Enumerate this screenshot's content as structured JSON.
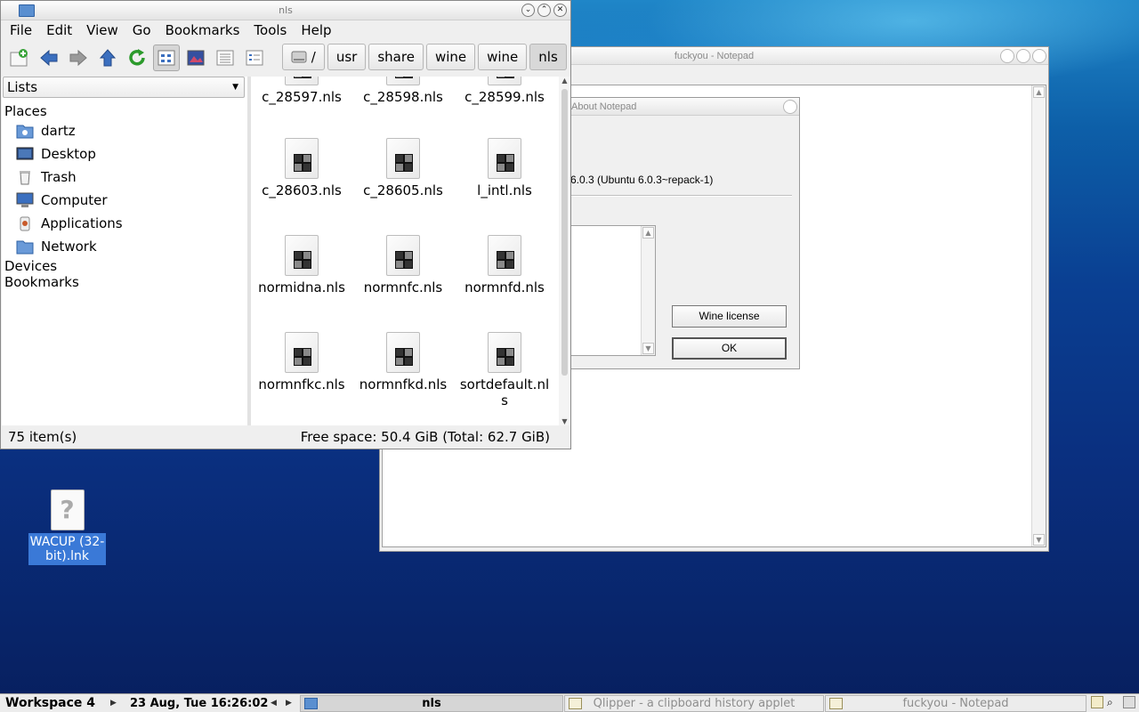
{
  "notepad": {
    "title": "fuckyou - Notepad"
  },
  "about": {
    "title": "About Notepad",
    "version": "6.0.3 (Ubuntu 6.0.3~repack-1)",
    "license_label": "Wine license",
    "ok_label": "OK"
  },
  "filemanager": {
    "title": "nls",
    "menu": [
      "File",
      "Edit",
      "View",
      "Go",
      "Bookmarks",
      "Tools",
      "Help"
    ],
    "path": [
      "/",
      "usr",
      "share",
      "wine",
      "wine",
      "nls"
    ],
    "side_selector": "Lists",
    "places_header": "Places",
    "places": [
      "dartz",
      "Desktop",
      "Trash",
      "Computer",
      "Applications",
      "Network"
    ],
    "devices_header": "Devices",
    "bookmarks_header": "Bookmarks",
    "files": [
      "c_28597.nls",
      "c_28598.nls",
      "c_28599.nls",
      "c_28603.nls",
      "c_28605.nls",
      "l_intl.nls",
      "normidna.nls",
      "normnfc.nls",
      "normnfd.nls",
      "normnfkc.nls",
      "normnfkd.nls",
      "sortdefault.nls"
    ],
    "status_items": "75 item(s)",
    "status_space": "Free space: 50.4 GiB (Total: 62.7 GiB)"
  },
  "desktop": {
    "icon_label": "WACUP (32-bit).lnk"
  },
  "taskbar": {
    "workspace": "Workspace 4",
    "clock": "23 Aug, Tue 16:26:02",
    "tasks": [
      "nls",
      "Qlipper - a clipboard history applet",
      "fuckyou - Notepad"
    ]
  }
}
